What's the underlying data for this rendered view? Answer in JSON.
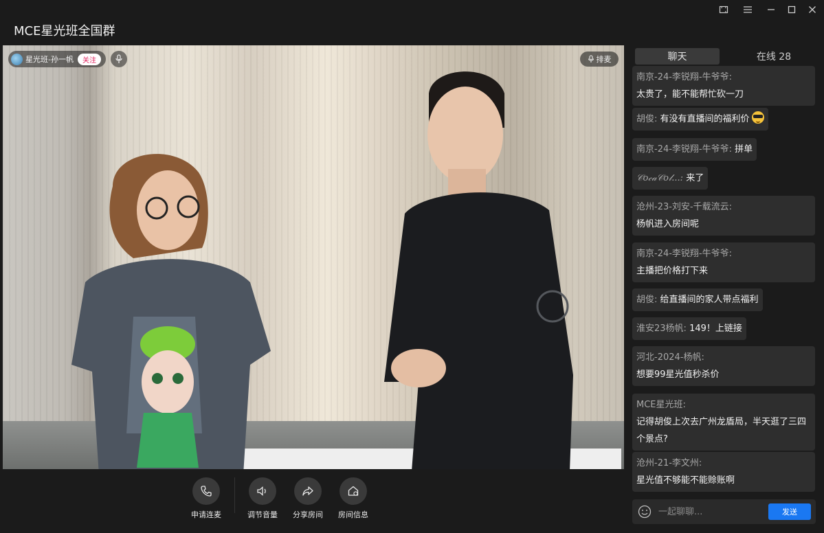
{
  "window": {
    "title": "MCE星光班全国群",
    "controls": [
      "screenshot-icon",
      "menu-icon",
      "minimize-icon",
      "maximize-icon",
      "close-icon"
    ]
  },
  "stream": {
    "host_name": "星光班-孙一帆",
    "follow_label": "关注",
    "queue_label": "排麦"
  },
  "controls": [
    {
      "label": "申请连麦",
      "icon": "phone-icon"
    },
    {
      "label": "调节音量",
      "icon": "speaker-icon"
    },
    {
      "label": "分享房间",
      "icon": "share-icon"
    },
    {
      "label": "房间信息",
      "icon": "room-info-icon"
    }
  ],
  "chat": {
    "tabs": {
      "chat": "聊天",
      "online": "在线 28"
    },
    "messages": [
      {
        "user": "南京-24-李锐翔-牛爷爷:",
        "text": "太贵了，能不能帮忙砍一刀",
        "layout": "block"
      },
      {
        "user": "胡俊:",
        "text": "有没有直播间的福利价",
        "layout": "inline",
        "emoji": "sunglasses-emoji"
      },
      {
        "user": "南京-24-李锐翔-牛爷爷:",
        "text": "拼单",
        "layout": "inline"
      },
      {
        "user": "𝒞𝑜𝒸𝒶𝒞𝑜𝓁...:",
        "text": "来了",
        "layout": "inline"
      },
      {
        "user": "沧州-23-刘安-千载流云:",
        "text": "杨帆进入房间呢",
        "layout": "block"
      },
      {
        "user": "南京-24-李锐翔-牛爷爷:",
        "text": "主播把价格打下来",
        "layout": "block"
      },
      {
        "user": "胡俊:",
        "text": "给直播间的家人带点福利",
        "layout": "inline"
      },
      {
        "user": "淮安23杨帆:",
        "text": "149！上链接",
        "layout": "inline"
      },
      {
        "user": "河北-2024-杨帆:",
        "text": "想要99星光值秒杀价",
        "layout": "block"
      },
      {
        "user": "MCE星光班:",
        "text": "记得胡俊上次去广州龙盾局，半天逛了三四个景点?",
        "layout": "block"
      },
      {
        "user": "沧州-21-李文州:",
        "text": "星光值不够能不能赊账啊",
        "layout": "block"
      }
    ],
    "input_placeholder": "一起聊聊...",
    "send_label": "发送"
  }
}
